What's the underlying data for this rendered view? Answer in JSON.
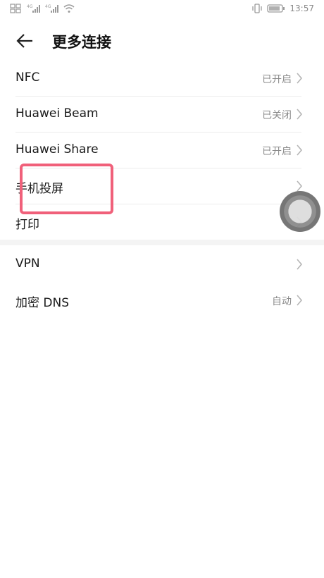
{
  "status_bar": {
    "time": "13:57",
    "icons": [
      "hd-icon",
      "signal-4g-icon",
      "signal-4g-icon",
      "wifi-icon",
      "vibrate-icon",
      "battery-icon"
    ]
  },
  "header": {
    "title": "更多连接",
    "back_icon": "back-arrow-icon"
  },
  "group1": [
    {
      "label": "NFC",
      "value": "已开启"
    },
    {
      "label": "Huawei Beam",
      "value": "已关闭"
    },
    {
      "label": "Huawei Share",
      "value": "已开启"
    },
    {
      "label": "手机投屏",
      "value": ""
    },
    {
      "label": "打印",
      "value": ""
    }
  ],
  "group2": [
    {
      "label": "VPN",
      "value": ""
    },
    {
      "label": "加密 DNS",
      "value": "自动"
    }
  ],
  "colors": {
    "highlight": "#f0607a",
    "secondary_text": "#8a8a8a",
    "primary_text": "#1a1a1a"
  }
}
